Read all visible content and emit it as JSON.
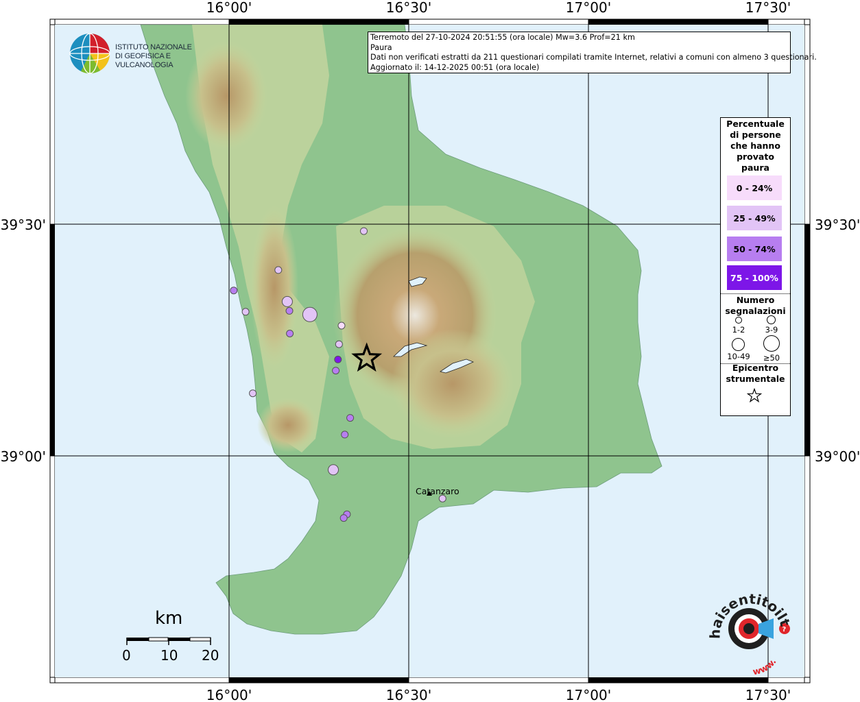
{
  "map": {
    "lon_labels": [
      "16°00'",
      "16°30'",
      "17°00'",
      "17°30'"
    ],
    "lat_labels": [
      "39°30'",
      "39°00'"
    ],
    "colors": {
      "sea": "#e1f1fb",
      "lowland": "#8fc48e",
      "hills": "#c9d7a0",
      "mountains": "#b09a6a",
      "peaks": "#e8e4dc",
      "grid": "#000000"
    }
  },
  "institute": {
    "name_line1": "ISTITUTO NAZIONALE",
    "name_line2": "DI GEOFISICA E VULCANOLOGIA",
    "logo_icon": "globe-logo-icon"
  },
  "info": {
    "line1": "Terremoto del 27-10-2024 20:51:55 (ora locale) Mw=3.6 Prof=21 km",
    "line2": "Paura",
    "line3": "Dati non verificati estratti da 211 questionari compilati tramite Internet, relativi a comuni con almeno 3 questionari.",
    "line4": "Aggiornato il: 14-12-2025 00:51 (ora locale)"
  },
  "legend": {
    "title": [
      "Percentuale",
      "di persone",
      "che hanno",
      "provato",
      "paura"
    ],
    "classes": [
      {
        "label": "0 - 24%",
        "color": "#f7dcfb",
        "text_color": "#000000"
      },
      {
        "label": "25 - 49%",
        "color": "#e2c4f6",
        "text_color": "#000000"
      },
      {
        "label": "50 - 74%",
        "color": "#b77ef0",
        "text_color": "#000000"
      },
      {
        "label": "75 - 100%",
        "color": "#7d16e8",
        "text_color": "#ffffff"
      }
    ],
    "count_title": [
      "Numero",
      "segnalazioni"
    ],
    "count_classes": [
      "1-2",
      "3-9",
      "10-49",
      "≥50"
    ],
    "epicenter_title": [
      "Epicentro",
      "strumentale"
    ],
    "epicenter_icon": "star-icon"
  },
  "places": [
    {
      "name": "Catanzaro"
    }
  ],
  "observations": [
    {
      "lon": 16.375,
      "lat": 39.485,
      "class": 1,
      "size": 1
    },
    {
      "lon": 16.137,
      "lat": 39.401,
      "class": 1,
      "size": 1
    },
    {
      "lon": 16.013,
      "lat": 39.357,
      "class": 2,
      "size": 1
    },
    {
      "lon": 16.162,
      "lat": 39.333,
      "class": 1,
      "size": 2
    },
    {
      "lon": 16.168,
      "lat": 39.313,
      "class": 2,
      "size": 1
    },
    {
      "lon": 16.046,
      "lat": 39.311,
      "class": 1,
      "size": 1
    },
    {
      "lon": 16.225,
      "lat": 39.305,
      "class": 1,
      "size": 3
    },
    {
      "lon": 16.313,
      "lat": 39.281,
      "class": 0,
      "size": 1
    },
    {
      "lon": 16.169,
      "lat": 39.264,
      "class": 2,
      "size": 1
    },
    {
      "lon": 16.306,
      "lat": 39.241,
      "class": 1,
      "size": 1
    },
    {
      "lon": 16.303,
      "lat": 39.208,
      "class": 3,
      "size": 1
    },
    {
      "lon": 16.297,
      "lat": 39.184,
      "class": 2,
      "size": 1
    },
    {
      "lon": 16.066,
      "lat": 39.135,
      "class": 1,
      "size": 1
    },
    {
      "lon": 16.337,
      "lat": 39.082,
      "class": 2,
      "size": 1
    },
    {
      "lon": 16.322,
      "lat": 39.046,
      "class": 2,
      "size": 1
    },
    {
      "lon": 16.29,
      "lat": 38.97,
      "class": 1,
      "size": 2
    },
    {
      "lon": 16.594,
      "lat": 38.908,
      "class": 1,
      "size": 1
    },
    {
      "lon": 16.328,
      "lat": 38.874,
      "class": 2,
      "size": 1
    },
    {
      "lon": 16.319,
      "lat": 38.866,
      "class": 2,
      "size": 1
    }
  ],
  "epicenter": {
    "lon": 16.383,
    "lat": 39.21
  },
  "scale_bar": {
    "unit": "km",
    "labels": [
      "0",
      "10",
      "20"
    ]
  },
  "site_logo": {
    "text": "haisentitoilterremoto.it",
    "prefix": "www.",
    "icon": "megaphone-logo-icon"
  }
}
